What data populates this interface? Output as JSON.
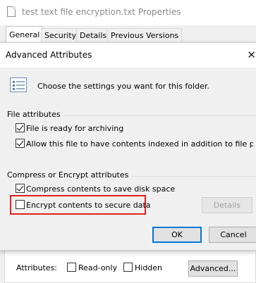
{
  "properties_window": {
    "title": "test text file encryption.txt Properties",
    "tabs": [
      {
        "label": "General",
        "active": true
      },
      {
        "label": "Security",
        "active": false
      },
      {
        "label": "Details",
        "active": false
      },
      {
        "label": "Previous Versions",
        "active": false
      }
    ],
    "attributes": {
      "label": "Attributes:",
      "read_only": {
        "label": "Read-only",
        "checked": false
      },
      "hidden": {
        "label": "Hidden",
        "checked": false
      },
      "advanced_button": "Advanced..."
    }
  },
  "dialog": {
    "title": "Advanced Attributes",
    "close_glyph": "✕",
    "intro": "Choose the settings you want for this folder.",
    "file_attributes": {
      "heading": "File attributes",
      "archive": {
        "label": "File is ready for archiving",
        "checked": true
      },
      "index": {
        "label": "Allow this file to have contents indexed in addition to file properties",
        "checked": true
      }
    },
    "compress_encrypt": {
      "heading": "Compress or Encrypt attributes",
      "compress": {
        "label": "Compress contents to save disk space",
        "checked": true
      },
      "encrypt": {
        "label": "Encrypt contents to secure data",
        "checked": false
      },
      "details_button": "Details"
    },
    "ok_button": "OK",
    "cancel_button": "Cancel"
  },
  "colors": {
    "highlight": "#e02020",
    "disabled_text": "#a0a0a0"
  }
}
